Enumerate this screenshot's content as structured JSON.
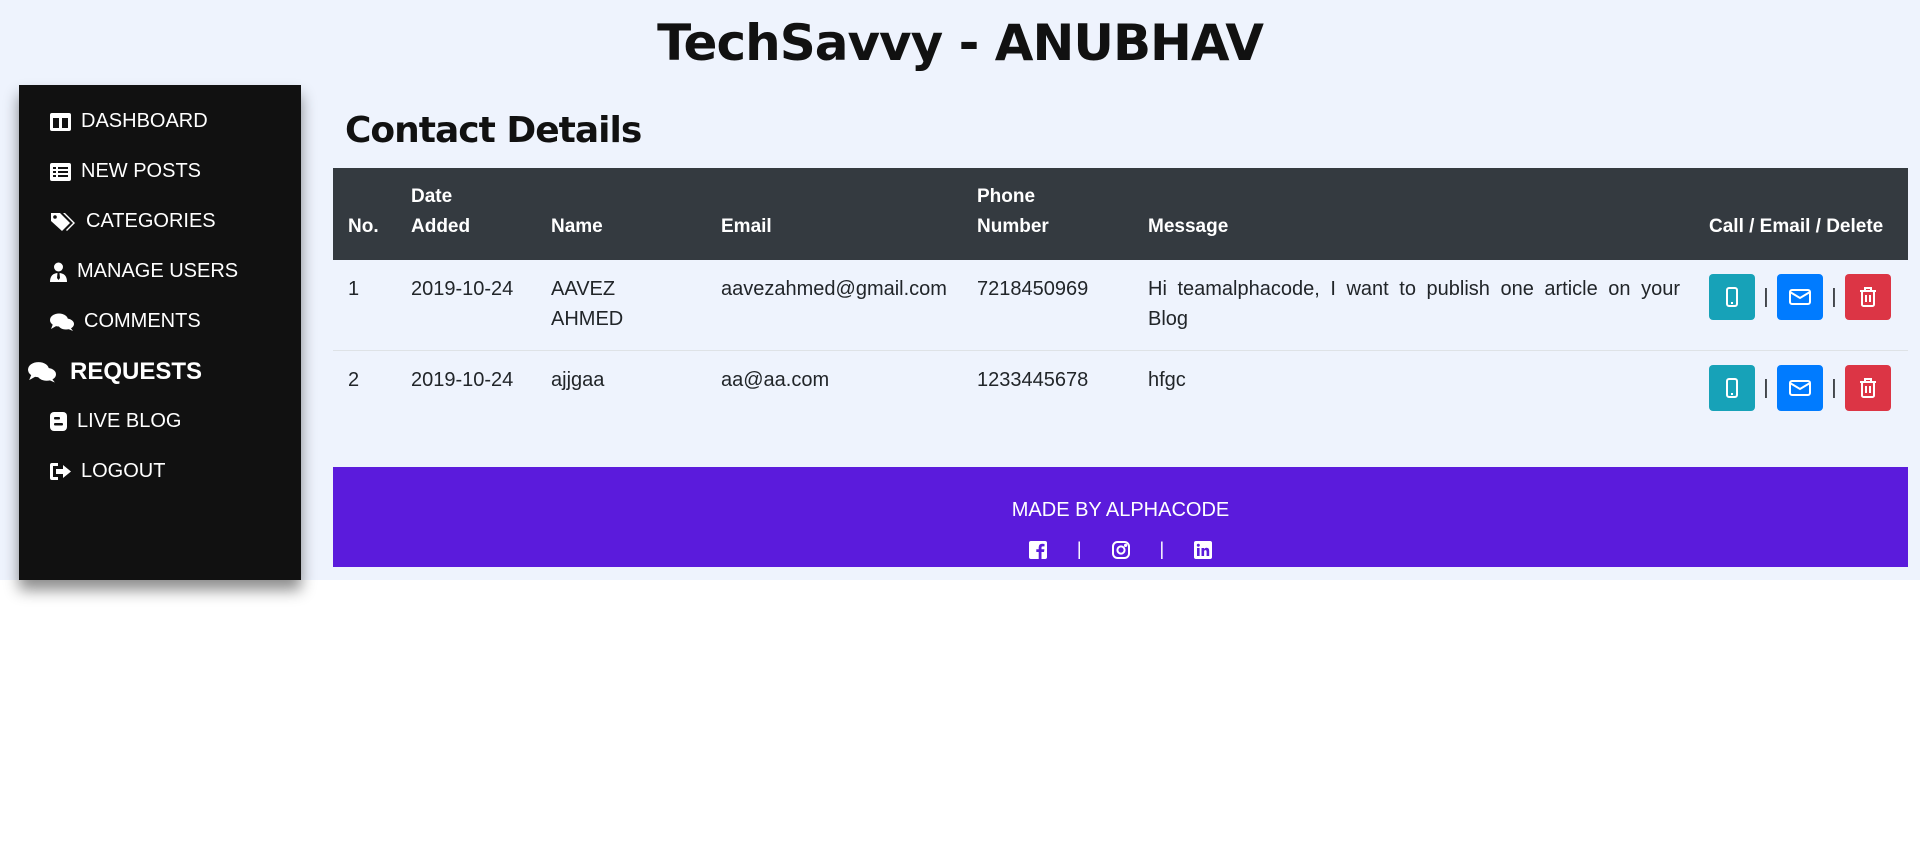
{
  "site": {
    "title": "TechSavvy - ANUBHAV"
  },
  "sidebar": {
    "items": [
      {
        "label": "DASHBOARD",
        "icon": "columns-icon"
      },
      {
        "label": "NEW POSTS",
        "icon": "list-icon"
      },
      {
        "label": "CATEGORIES",
        "icon": "tags-icon"
      },
      {
        "label": "MANAGE USERS",
        "icon": "user-tie-icon"
      },
      {
        "label": "COMMENTS",
        "icon": "comments-icon"
      },
      {
        "label": "REQUESTS",
        "icon": "comments-icon",
        "active": true
      },
      {
        "label": "LIVE BLOG",
        "icon": "blogger-icon"
      },
      {
        "label": "LOGOUT",
        "icon": "sign-out-icon"
      }
    ]
  },
  "main": {
    "title": "Contact Details",
    "table": {
      "headers": [
        "No.",
        "Date",
        "Added",
        "Name",
        "Email",
        "Phone",
        "Number",
        "Message",
        "Call / Email / Delete"
      ],
      "rows": [
        {
          "no": "1",
          "date": "2019-10-24",
          "name_line1": "AAVEZ",
          "name_line2": "AHMED",
          "email": "aavezahmed@gmail.com",
          "phone": "7218450969",
          "message": "Hi teamalphacode, I want to publish one article on your Blog"
        },
        {
          "no": "2",
          "date": "2019-10-24",
          "name_line1": "ajjgaa",
          "name_line2": "",
          "email": "aa@aa.com",
          "phone": "1233445678",
          "message": "hfgc"
        }
      ],
      "separator": "|"
    }
  },
  "footer": {
    "text": "MADE BY ALPHACODE",
    "separator": "|",
    "social": [
      "facebook-icon",
      "instagram-icon",
      "linkedin-icon"
    ]
  },
  "colors": {
    "page_bg": "#eef3fd",
    "sidebar_bg": "#111111",
    "table_header_bg": "#343a40",
    "call_button": "#17a2b8",
    "email_button": "#007bff",
    "delete_button": "#dc3545",
    "footer_bg": "#5b1bdc"
  }
}
